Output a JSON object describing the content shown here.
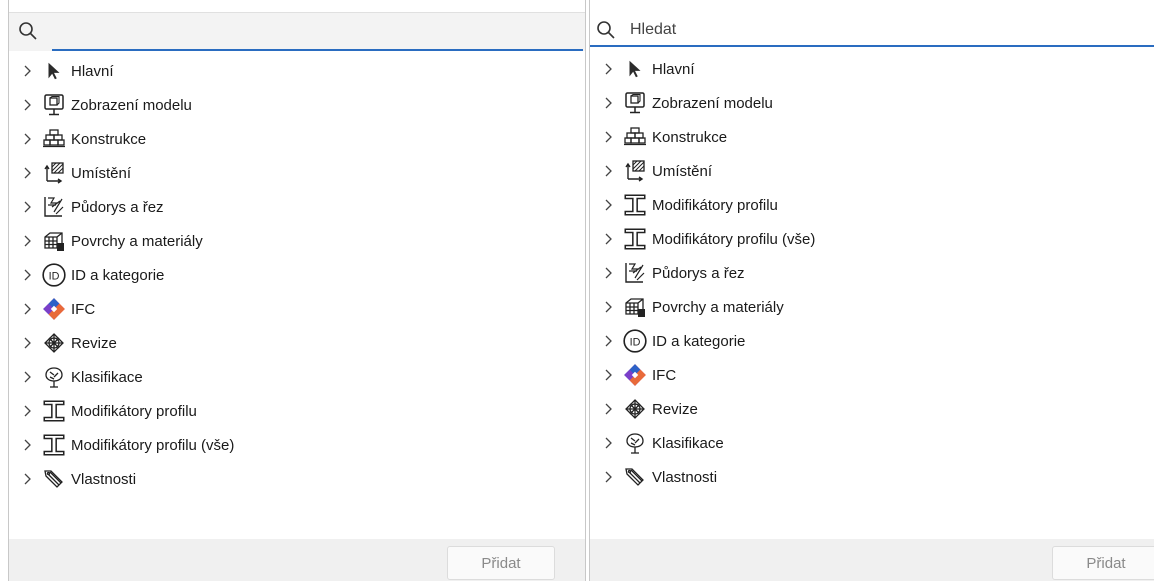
{
  "panels": [
    {
      "search": {
        "value": "",
        "placeholder": ""
      },
      "items": [
        {
          "icon": "cursor-arrow-icon",
          "label": "Hlavní"
        },
        {
          "icon": "model-display-icon",
          "label": "Zobrazení modelu"
        },
        {
          "icon": "construction-icon",
          "label": "Konstrukce"
        },
        {
          "icon": "placement-icon",
          "label": "Umístění"
        },
        {
          "icon": "plan-section-icon",
          "label": "Půdorys a řez"
        },
        {
          "icon": "surfaces-materials-icon",
          "label": "Povrchy a materiály"
        },
        {
          "icon": "id-category-icon",
          "label": "ID a kategorie"
        },
        {
          "icon": "ifc-icon",
          "label": "IFC"
        },
        {
          "icon": "revision-icon",
          "label": "Revize"
        },
        {
          "icon": "classification-icon",
          "label": "Klasifikace"
        },
        {
          "icon": "profile-modifier-icon",
          "label": "Modifikátory profilu"
        },
        {
          "icon": "profile-modifier-icon",
          "label": "Modifikátory profilu (vše)"
        },
        {
          "icon": "properties-icon",
          "label": "Vlastnosti"
        }
      ],
      "add_label": "Přidat"
    },
    {
      "search": {
        "value": "",
        "placeholder": "Hledat"
      },
      "items": [
        {
          "icon": "cursor-arrow-icon",
          "label": "Hlavní"
        },
        {
          "icon": "model-display-icon",
          "label": "Zobrazení modelu"
        },
        {
          "icon": "construction-icon",
          "label": "Konstrukce"
        },
        {
          "icon": "placement-icon",
          "label": "Umístění"
        },
        {
          "icon": "profile-modifier-icon",
          "label": "Modifikátory profilu"
        },
        {
          "icon": "profile-modifier-icon",
          "label": "Modifikátory profilu (vše)"
        },
        {
          "icon": "plan-section-icon",
          "label": "Půdorys a řez"
        },
        {
          "icon": "surfaces-materials-icon",
          "label": "Povrchy a materiály"
        },
        {
          "icon": "id-category-icon",
          "label": "ID a kategorie"
        },
        {
          "icon": "ifc-icon",
          "label": "IFC"
        },
        {
          "icon": "revision-icon",
          "label": "Revize"
        },
        {
          "icon": "classification-icon",
          "label": "Klasifikace"
        },
        {
          "icon": "properties-icon",
          "label": "Vlastnosti"
        }
      ],
      "add_label": "Přidat"
    }
  ],
  "colors": {
    "accent": "#2a6cc0",
    "footer_bg": "#f0f0f0",
    "disabled_text": "#8a8a8a"
  }
}
